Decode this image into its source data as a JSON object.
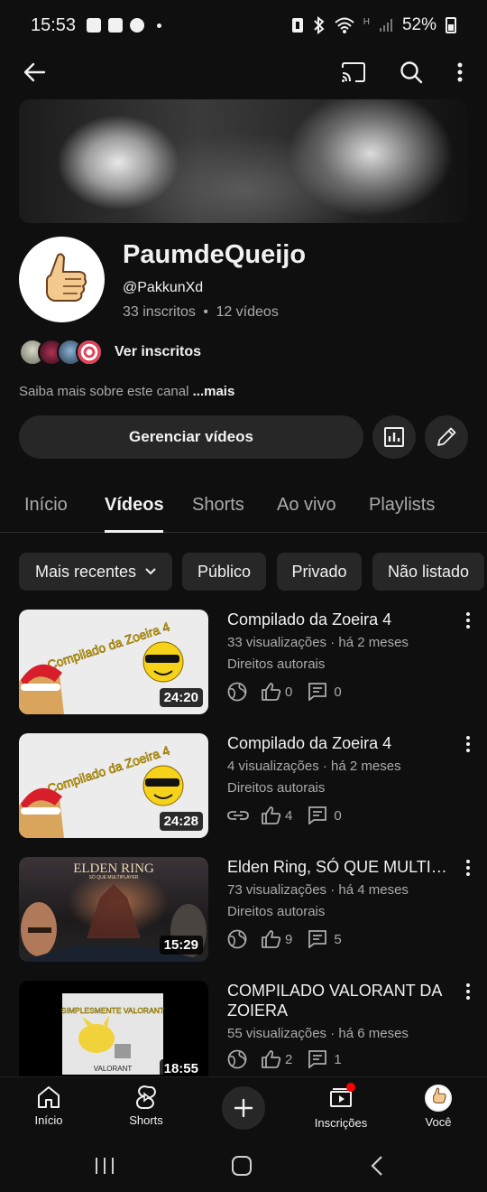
{
  "status_bar": {
    "time": "15:53",
    "battery": "52%",
    "network": "H"
  },
  "channel": {
    "name": "PaumdeQueijo",
    "handle": "@PakkunXd",
    "subscribers": "33 inscritos",
    "separator": "•",
    "video_count": "12 vídeos",
    "view_subscribers": "Ver inscritos",
    "about_prefix": "Saiba mais sobre este canal",
    "about_more": "...mais",
    "manage_videos": "Gerenciar vídeos"
  },
  "tabs": [
    "Início",
    "Vídeos",
    "Shorts",
    "Ao vivo",
    "Playlists"
  ],
  "chips": [
    "Mais recentes",
    "Público",
    "Privado",
    "Não listado"
  ],
  "videos": [
    {
      "title": "Compilado da Zoeira 4",
      "meta": "33 visualizações · há 2 meses",
      "rights": "Direitos autorais",
      "likes": "0",
      "comments": "0",
      "duration": "24:20",
      "thumb_text": "Compilado da Zoeira 4",
      "visibility_icon": "globe-icon"
    },
    {
      "title": "Compilado da Zoeira 4",
      "meta": "4 visualizações · há 2 meses",
      "rights": "Direitos autorais",
      "likes": "4",
      "comments": "0",
      "duration": "24:28",
      "thumb_text": "Compilado da Zoeira 4",
      "visibility_icon": "link-icon"
    },
    {
      "title": "Elden Ring, SÓ QUE MULTIPL...",
      "meta": "73 visualizações · há 4 meses",
      "rights": "Direitos autorais",
      "likes": "9",
      "comments": "5",
      "duration": "15:29",
      "thumb_text": "ELDEN RING",
      "thumb_subtext": "SÓ QUE MULTIPLAYER",
      "visibility_icon": "globe-icon"
    },
    {
      "title": "COMPILADO VALORANT DA ZOIERA",
      "meta": "55 visualizações · há 6 meses",
      "likes": "2",
      "comments": "1",
      "duration": "18:55",
      "thumb_text": "SIMPLESMENTE VALORANT",
      "thumb_subtext": "VALORANT",
      "visibility_icon": "globe-icon"
    }
  ],
  "bottom_nav": [
    "Início",
    "Shorts",
    "Inscrições",
    "Você"
  ],
  "colors": {
    "background": "#0f0f0f",
    "surface": "#272727",
    "accent_red": "#ff0000",
    "secondary_text": "#aaaaaa"
  }
}
